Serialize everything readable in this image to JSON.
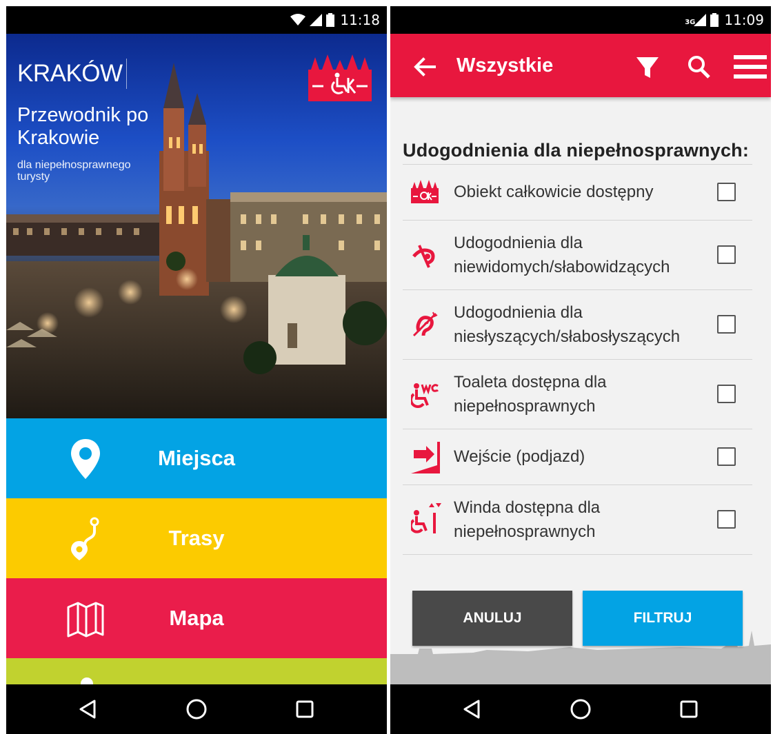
{
  "left_screen": {
    "status": {
      "time": "11:18"
    },
    "hero": {
      "city": "KRAKÓW",
      "subtitle": "Przewodnik po Krakowie",
      "tagline": "dla niepełnosprawnego turysty"
    },
    "menu": [
      {
        "label": "Miejsca",
        "icon": "map-pin-icon",
        "color": "#03a3e4"
      },
      {
        "label": "Trasy",
        "icon": "route-icon",
        "color": "#fccb00"
      },
      {
        "label": "Mapa",
        "icon": "map-icon",
        "color": "#ea1d4b"
      },
      {
        "icon": "dot-icon",
        "color": "#c1d22f"
      }
    ]
  },
  "right_screen": {
    "status": {
      "network": "3G",
      "time": "11:09"
    },
    "toolbar": {
      "title": "Wszystkie",
      "color": "#e8173e"
    },
    "section_title": "Udogodnienia dla niepełnosprawnych:",
    "options": [
      {
        "label": "Obiekt całkowicie dostępny",
        "icon": "fully-accessible-icon",
        "checked": false
      },
      {
        "label": "Udogodnienia dla niewidomych/słabowidzących",
        "icon": "blind-icon",
        "checked": false
      },
      {
        "label": "Udogodnienia dla niesłyszących/słabosłyszących",
        "icon": "deaf-icon",
        "checked": false
      },
      {
        "label": "Toaleta dostępna dla niepełnosprawnych",
        "icon": "accessible-wc-icon",
        "checked": false
      },
      {
        "label": "Wejście (podjazd)",
        "icon": "ramp-entrance-icon",
        "checked": false
      },
      {
        "label": "Winda dostępna dla niepełnosprawnych",
        "icon": "accessible-elevator-icon",
        "checked": false
      }
    ],
    "buttons": {
      "cancel": "ANULUJ",
      "filter": "FILTRUJ"
    }
  }
}
